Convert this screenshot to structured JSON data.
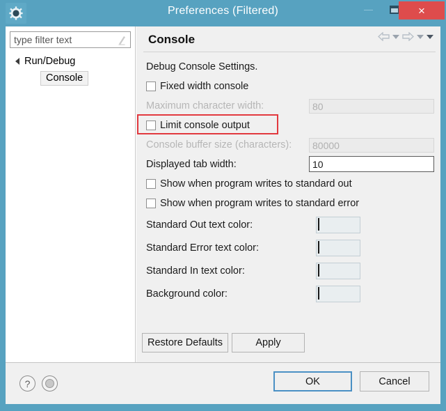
{
  "window": {
    "title": "Preferences (Filtered)",
    "app_icon": "gear-icon",
    "titlebar_color": "#57a2c0",
    "close_button_color": "#de4c4c",
    "controls": {
      "minimize": "minimize-icon",
      "maximize": "restore-window-icon",
      "close": "×"
    }
  },
  "sidebar": {
    "filter": {
      "placeholder": "type filter text",
      "value": "",
      "clear_icon": "filter-clear-icon"
    },
    "tree": [
      {
        "label": "Run/Debug",
        "level": 0,
        "expanded": true,
        "selected": false
      },
      {
        "label": "Console",
        "level": 1,
        "expanded": false,
        "selected": true
      }
    ]
  },
  "content": {
    "title": "Console",
    "nav": {
      "back": "back-arrow-icon",
      "back_menu": "chevron-down-icon",
      "forward": "forward-arrow-icon",
      "forward_menu": "chevron-down-icon",
      "view_menu": "chevron-down-icon"
    },
    "group_label": "Debug Console Settings.",
    "settings": [
      {
        "kind": "checkbox",
        "label": "Fixed width console",
        "checked": false,
        "enabled": true
      },
      {
        "kind": "textfield",
        "label": "Maximum character width:",
        "value": "80",
        "enabled": false
      },
      {
        "kind": "checkbox",
        "label": "Limit console output",
        "checked": false,
        "enabled": true,
        "highlighted": true
      },
      {
        "kind": "textfield",
        "label": "Console buffer size (characters):",
        "value": "80000",
        "enabled": false
      },
      {
        "kind": "textfield",
        "label": "Displayed tab width:",
        "value": "10",
        "enabled": true
      },
      {
        "kind": "checkbox",
        "label": "Show when program writes to standard out",
        "checked": false,
        "enabled": true
      },
      {
        "kind": "checkbox",
        "label": "Show when program writes to standard error",
        "checked": false,
        "enabled": true
      }
    ],
    "colors": [
      {
        "label": "Standard Out text color:",
        "value": "#000000"
      },
      {
        "label": "Standard Error text color:",
        "value": "#fb0f0f"
      },
      {
        "label": "Standard In text color:",
        "value": "#22c77c"
      },
      {
        "label": "Background color:",
        "value": "#ffffff"
      }
    ],
    "restore_defaults_label": "Restore Defaults",
    "apply_label": "Apply"
  },
  "footer": {
    "help_icon": "question-mark-icon",
    "help_glyph": "?",
    "apply_all_icon": "apply-to-all-icon",
    "ok_label": "OK",
    "cancel_label": "Cancel"
  },
  "annotation": {
    "color": "#e2393f",
    "target": "Limit console output"
  }
}
